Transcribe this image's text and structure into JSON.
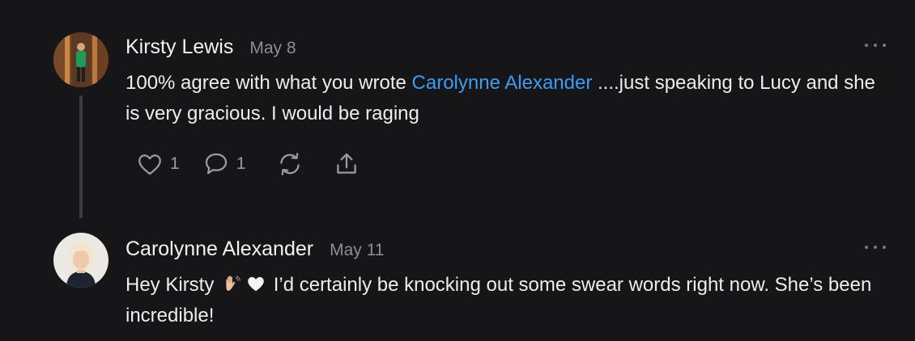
{
  "comments": [
    {
      "author": "Kirsty Lewis",
      "date": "May 8",
      "body_before": "100% agree with what you wrote ",
      "mention": "Carolynne Alexander",
      "body_after": " ....just speaking to Lucy and she is very gracious. I would be raging",
      "actions": {
        "like_count": "1",
        "reply_count": "1"
      }
    },
    {
      "author": "Carolynne Alexander",
      "date": "May 11",
      "body_part1": "Hey Kirsty",
      "emoji_1": "waving-hand",
      "emoji_2": "white-heart",
      "body_part2": " I’d certainly be knocking out some swear words right now. She’s been incredible!"
    }
  ],
  "colors": {
    "background": "#161618",
    "mention": "#3c9cf0",
    "muted": "#8d8d92"
  },
  "icons": [
    "heart-icon",
    "comment-icon",
    "restack-icon",
    "share-icon",
    "more-options-icon"
  ]
}
